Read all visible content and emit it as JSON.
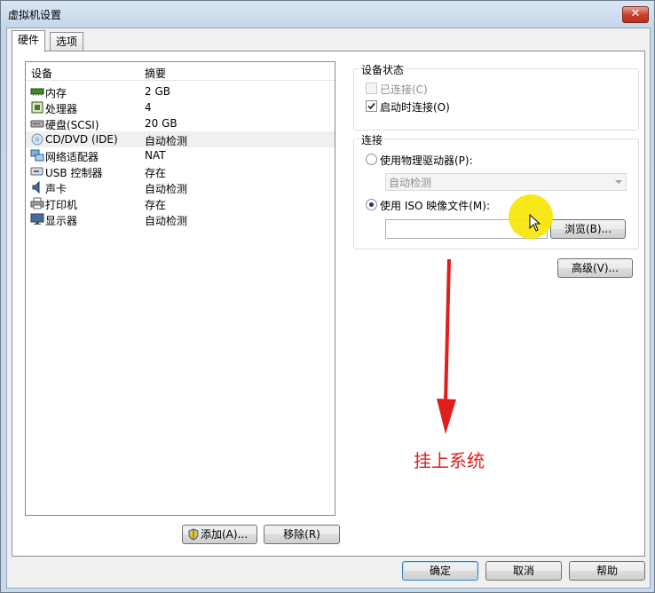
{
  "window": {
    "title": "虚拟机设置",
    "close_label": "✕"
  },
  "tabs": [
    {
      "label": "硬件"
    },
    {
      "label": "选项"
    }
  ],
  "device_list": {
    "col_device": "设备",
    "col_summary": "摘要",
    "rows": [
      {
        "name": "内存",
        "summary": "2 GB",
        "icon": "memory-icon"
      },
      {
        "name": "处理器",
        "summary": "4",
        "icon": "processor-icon"
      },
      {
        "name": "硬盘(SCSI)",
        "summary": "20 GB",
        "icon": "harddisk-icon"
      },
      {
        "name": "CD/DVD (IDE)",
        "summary": "自动检测",
        "icon": "cd-dvd-icon"
      },
      {
        "name": "网络适配器",
        "summary": "NAT",
        "icon": "network-adapter-icon"
      },
      {
        "name": "USB 控制器",
        "summary": "存在",
        "icon": "usb-icon"
      },
      {
        "name": "声卡",
        "summary": "自动检测",
        "icon": "sound-card-icon"
      },
      {
        "name": "打印机",
        "summary": "存在",
        "icon": "printer-icon"
      },
      {
        "name": "显示器",
        "summary": "自动检测",
        "icon": "display-icon"
      }
    ],
    "selected_index": 3
  },
  "list_buttons": {
    "add": "添加(A)...",
    "remove": "移除(R)"
  },
  "device_status": {
    "label": "设备状态",
    "connected": {
      "label": "已连接(C)",
      "checked": false,
      "disabled": true
    },
    "connect_on_start": {
      "label": "启动时连接(O)",
      "checked": true
    }
  },
  "connection": {
    "label": "连接",
    "physical_drive": {
      "label": "使用物理驱动器(P):",
      "selected": false
    },
    "drive_combo_value": "自动检测",
    "iso_image": {
      "label": "使用 ISO 映像文件(M):",
      "selected": true
    },
    "iso_path": "",
    "browse_label": "浏览(B)..."
  },
  "advanced_label": "高级(V)...",
  "footer": {
    "ok": "确定",
    "cancel": "取消",
    "help": "帮助"
  },
  "annotation": {
    "text": "挂上系统",
    "color": "#e01e1e"
  },
  "colors": {
    "selection": "#f0f0f0",
    "annotation_red": "#e01e1e",
    "highlight_yellow": "#f7e600"
  }
}
